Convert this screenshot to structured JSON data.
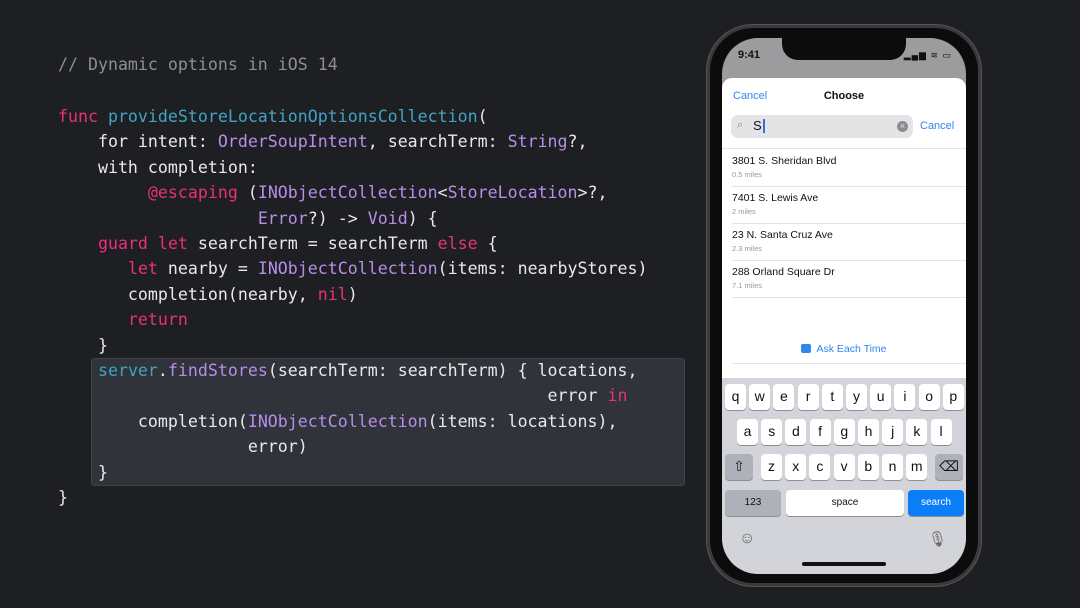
{
  "code": {
    "comment": "// Dynamic options in iOS 14",
    "lines": [
      [
        [
          "func ",
          "kw"
        ],
        [
          "provideStoreLocationOptionsCollection",
          "fn"
        ],
        [
          "(",
          "pl"
        ]
      ],
      [
        [
          "    for intent: ",
          "pl"
        ],
        [
          "OrderSoupIntent",
          "ty"
        ],
        [
          ", searchTerm: ",
          "pl"
        ],
        [
          "String",
          "ty"
        ],
        [
          "?,",
          "pl"
        ]
      ],
      [
        [
          "    with completion:",
          "pl"
        ]
      ],
      [
        [
          "         ",
          "pl"
        ],
        [
          "@escaping",
          "kw"
        ],
        [
          " (",
          "pl"
        ],
        [
          "INObjectCollection",
          "ty"
        ],
        [
          "<",
          "pl"
        ],
        [
          "StoreLocation",
          "ty"
        ],
        [
          ">?,",
          "pl"
        ]
      ],
      [
        [
          "                    ",
          "pl"
        ],
        [
          "Error",
          "ty"
        ],
        [
          "?) -> ",
          "pl"
        ],
        [
          "Void",
          "ty"
        ],
        [
          ") {",
          "pl"
        ]
      ],
      [
        [
          "    ",
          "pl"
        ],
        [
          "guard let",
          "kw"
        ],
        [
          " searchTerm = searchTerm ",
          "pl"
        ],
        [
          "else",
          "kw"
        ],
        [
          " {",
          "pl"
        ]
      ],
      [
        [
          "       ",
          "pl"
        ],
        [
          "let",
          "kw"
        ],
        [
          " nearby = ",
          "pl"
        ],
        [
          "INObjectCollection",
          "ty"
        ],
        [
          "(items: nearbyStores)",
          "pl"
        ]
      ],
      [
        [
          "       completion(nearby, ",
          "pl"
        ],
        [
          "nil",
          "kw"
        ],
        [
          ")",
          "pl"
        ]
      ],
      [
        [
          "       ",
          "pl"
        ],
        [
          "return",
          "kw"
        ]
      ],
      [
        [
          "    }",
          "pl"
        ]
      ],
      [
        [
          "    ",
          "pl"
        ],
        [
          "server",
          "fn"
        ],
        [
          ".",
          "pl"
        ],
        [
          "findStores",
          "ty"
        ],
        [
          "(searchTerm: searchTerm) { locations,",
          "pl"
        ]
      ],
      [
        [
          "                                                 error ",
          "pl"
        ],
        [
          "in",
          "kw"
        ]
      ],
      [
        [
          "        completion(",
          "pl"
        ],
        [
          "INObjectCollection",
          "ty"
        ],
        [
          "(items: locations),",
          "pl"
        ]
      ],
      [
        [
          "                   error)",
          "pl"
        ]
      ],
      [
        [
          "    }",
          "pl"
        ]
      ],
      [
        [
          "}",
          "pl"
        ]
      ]
    ]
  },
  "phone": {
    "status": {
      "time": "9:41",
      "signal": "▂▄▆ ≋ ▭"
    },
    "header": {
      "cancel": "Cancel",
      "title": "Choose"
    },
    "search": {
      "value": "S",
      "cancel": "Cancel"
    },
    "results": [
      {
        "title": "3801 S. Sheridan Blvd",
        "subtitle": "0.5 miles"
      },
      {
        "title": "7401 S. Lewis Ave",
        "subtitle": "2 miles"
      },
      {
        "title": "23 N. Santa Cruz Ave",
        "subtitle": "2.3 miles"
      },
      {
        "title": "288 Orland Square Dr",
        "subtitle": "7.1 miles"
      }
    ],
    "ask_each_time": "Ask Each Time",
    "keyboard": {
      "row1": [
        "q",
        "w",
        "e",
        "r",
        "t",
        "y",
        "u",
        "i",
        "o",
        "p"
      ],
      "row2": [
        "a",
        "s",
        "d",
        "f",
        "g",
        "h",
        "j",
        "k",
        "l"
      ],
      "row3": [
        "z",
        "x",
        "c",
        "v",
        "b",
        "n",
        "m"
      ],
      "shift": "⇧",
      "delete": "⌫",
      "numbers": "123",
      "space": "space",
      "search": "search",
      "emoji": "☺",
      "mic": "🎙"
    },
    "accent": "#2f86ec"
  }
}
